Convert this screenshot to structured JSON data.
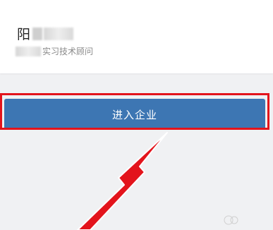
{
  "profile": {
    "name": "阳",
    "role": "实习技术顾问"
  },
  "actions": {
    "enter_company": "进入企业"
  },
  "annotation": {
    "highlight_color": "#e3141c",
    "button_color": "#3d76b3",
    "arrow_icon": "red-arrow-icon"
  }
}
